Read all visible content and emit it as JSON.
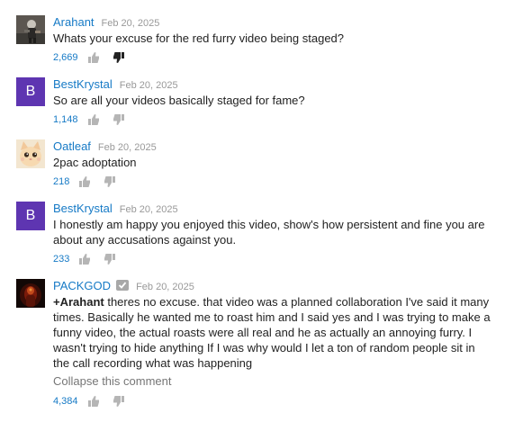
{
  "comments": [
    {
      "author": "Arahant",
      "date": "Feb 20, 2025",
      "text": "Whats your excuse for the red furry video being staged?",
      "likes": "2,669",
      "avatar": "photo-dark-figure"
    },
    {
      "author": "BestKrystal",
      "date": "Feb 20, 2025",
      "text": "So are all your videos basically staged for fame?",
      "likes": "1,148",
      "avatar": "letter",
      "avatar_letter": "B",
      "avatar_color": "#5e35b1"
    },
    {
      "author": "Oatleaf",
      "date": "Feb 20, 2025",
      "text": "2pac adoptation",
      "likes": "218",
      "avatar": "photo-cat"
    },
    {
      "author": "BestKrystal",
      "date": "Feb 20, 2025",
      "text": "I honestly am happy you enjoyed this video, show's how persistent and fine you are about any accusations against you.",
      "likes": "233",
      "avatar": "letter",
      "avatar_letter": "B",
      "avatar_color": "#5e35b1"
    },
    {
      "author": "PACKGOD",
      "date": "Feb 20, 2025",
      "verified": true,
      "mention": "+Arahant",
      "text": " theres no excuse. that video was a planned collaboration I've said it many times. Basically he wanted me to roast him and I said yes and I was trying to make a funny video, the actual roasts were all real and he as actually an annoying furry. I wasn't trying to hide anything If I was why would I let a ton of random people sit in the call recording what was happening",
      "collapse_label": "Collapse this comment",
      "likes": "4,384",
      "avatar": "photo-fire-figure"
    }
  ],
  "icons": {
    "like": "thumbs-up-icon",
    "dislike": "thumbs-down-icon",
    "verified": "verified-check-icon"
  },
  "colors": {
    "author_link": "#167ac6",
    "like_count": "#167ac6",
    "date": "#999999",
    "letter_avatar": "#5e35b1",
    "collapse_link": "#767676"
  }
}
